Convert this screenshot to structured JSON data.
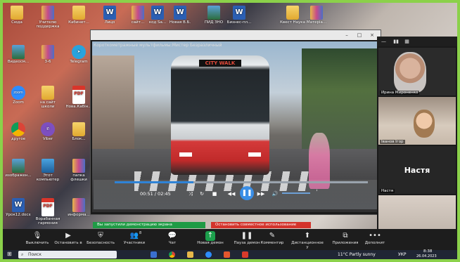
{
  "desktop": {
    "icons": [
      {
        "label": "Сюда",
        "type": "folder"
      },
      {
        "label": "Учителю поддержка",
        "type": "zip"
      },
      {
        "label": "Кабинет...",
        "type": "folder"
      },
      {
        "label": "Лицо",
        "type": "word"
      },
      {
        "label": "сайт...",
        "type": "zip"
      },
      {
        "label": "код Sa...",
        "type": "word"
      },
      {
        "label": "Новая В.Б.",
        "type": "word"
      },
      {
        "label": "ПИД ЗНО",
        "type": "img"
      },
      {
        "label": "Бизнес-пл...",
        "type": "word"
      },
      {
        "label": "Квест Наука",
        "type": "folder"
      },
      {
        "label": "Матеріа...",
        "type": "zip"
      },
      {
        "label": "Видеосм...",
        "type": "img"
      },
      {
        "label": "3-6",
        "type": "zip"
      },
      {
        "label": "Telegram",
        "type": "tg"
      },
      {
        "label": "Zoom",
        "type": "zoom"
      },
      {
        "label": "на сайт школи",
        "type": "folder"
      },
      {
        "label": "Нова.Кабін...",
        "type": "pdf"
      },
      {
        "label": "другое",
        "type": "chrome"
      },
      {
        "label": "Viber",
        "type": "viber"
      },
      {
        "label": "Блок...",
        "type": "folder"
      },
      {
        "label": "изображен...",
        "type": "img"
      },
      {
        "label": "Этот компьютер",
        "type": "pc"
      },
      {
        "label": "папка флешки",
        "type": "zip"
      },
      {
        "label": "Урок12.docx",
        "type": "word"
      },
      {
        "label": "Boрабанная гармония",
        "type": "pdf"
      },
      {
        "label": "информа...",
        "type": "zip"
      }
    ]
  },
  "player": {
    "window_title": "",
    "video_title": "Короткометражные мультфильмы:Мистер Безразличный",
    "bus_sign": "CITY WALK",
    "time": "00:51 / 02:45",
    "progress": 0.31,
    "window_buttons": [
      "–",
      "□",
      "×"
    ]
  },
  "zoom_panel": {
    "header_icons": [
      "minimize-icon",
      "gallery-icon",
      "grid-icon"
    ],
    "participants": [
      {
        "name": "Ирина Мироненко"
      },
      {
        "name": "Іванов Ігор"
      },
      {
        "name": "Настя",
        "display_name": "Настя"
      }
    ]
  },
  "zoom_toolbar": {
    "share_banner": "Вы запустили демонстрацию экрана",
    "stop_banner": "Остановить совместное использование",
    "participants_count": "8",
    "buttons": [
      {
        "label": "Выключить",
        "icon": "microphone-icon"
      },
      {
        "label": "Остановить в",
        "icon": "camera-icon"
      },
      {
        "label": "Безопасность",
        "icon": "shield-icon"
      },
      {
        "label": "Участники",
        "icon": "participants-icon"
      },
      {
        "label": "Чат",
        "icon": "chat-icon"
      },
      {
        "label": "Новая демон",
        "icon": "share-icon"
      },
      {
        "label": "Пауза демон",
        "icon": "pause-icon"
      },
      {
        "label": "Комментир",
        "icon": "pen-icon"
      },
      {
        "label": "Дистанционное у",
        "icon": "remote-control-icon"
      },
      {
        "label": "Приложения",
        "icon": "apps-icon"
      },
      {
        "label": "Дополнит",
        "icon": "more-icon"
      }
    ]
  },
  "taskbar": {
    "search_placeholder": "Поиск",
    "weather": "11°C  Partly sunny",
    "language": "УКР",
    "time": "8:38",
    "date": "26.04.2023"
  }
}
